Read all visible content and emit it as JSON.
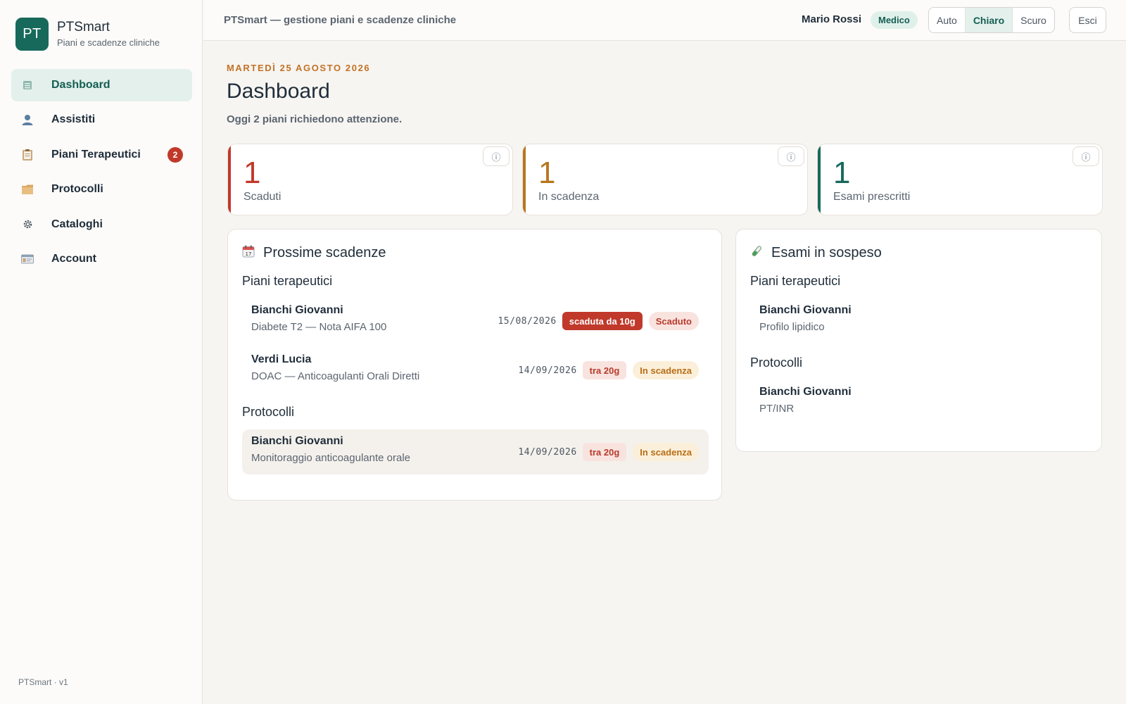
{
  "sidebar": {
    "logo_text": "PT",
    "brand_name": "PTSmart",
    "brand_sub": "Piani e scadenze cliniche",
    "items": [
      {
        "label": "Dashboard",
        "icon": "dashboard-icon",
        "active": true
      },
      {
        "label": "Assistiti",
        "icon": "user-icon"
      },
      {
        "label": "Piani Terapeutici",
        "icon": "clipboard-icon",
        "badge": "2"
      },
      {
        "label": "Protocolli",
        "icon": "folder-icon"
      },
      {
        "label": "Cataloghi",
        "icon": "gear-icon"
      },
      {
        "label": "Account",
        "icon": "id-card-icon"
      }
    ],
    "footer": "PTSmart · v1"
  },
  "topbar": {
    "title": "PTSmart — gestione piani e scadenze cliniche",
    "user": "Mario Rossi",
    "role": "Medico",
    "theme_options": [
      "Auto",
      "Chiaro",
      "Scuro"
    ],
    "theme_selected": "Chiaro",
    "logout": "Esci"
  },
  "main": {
    "date": "MARTEDÌ 25 AGOSTO 2026",
    "title": "Dashboard",
    "subtitle": "Oggi 2 piani richiedono attenzione.",
    "info_glyph": "ⓘ",
    "stats": [
      {
        "value": "1",
        "label": "Scaduti",
        "color": "#c0392b"
      },
      {
        "value": "1",
        "label": "In scadenza",
        "color": "#b8761e"
      },
      {
        "value": "1",
        "label": "Esami prescritti",
        "color": "#17695c"
      }
    ]
  },
  "deadlines": {
    "title": "Prossime scadenze",
    "icon": "calendar-icon",
    "plans_heading": "Piani terapeutici",
    "plans": [
      {
        "name": "Bianchi Giovanni",
        "desc": "Diabete T2 — Nota AIFA 100",
        "date": "15/08/2026",
        "delta": "scaduta da 10g",
        "status": "Scaduto"
      },
      {
        "name": "Verdi Lucia",
        "desc": "DOAC — Anticoagulanti Orali Diretti",
        "date": "14/09/2026",
        "delta": "tra 20g",
        "status": "In scadenza"
      }
    ],
    "protocols_heading": "Protocolli",
    "protocols": [
      {
        "name": "Bianchi Giovanni",
        "desc": "Monitoraggio anticoagulante orale",
        "date": "14/09/2026",
        "delta": "tra 20g",
        "status": "In scadenza"
      }
    ]
  },
  "pending": {
    "title": "Esami in sospeso",
    "icon": "test-tube-icon",
    "plans_heading": "Piani terapeutici",
    "plans": [
      {
        "name": "Bianchi Giovanni",
        "desc": "Profilo lipidico"
      }
    ],
    "protocols_heading": "Protocolli",
    "protocols": [
      {
        "name": "Bianchi Giovanni",
        "desc": "PT/INR"
      }
    ]
  }
}
